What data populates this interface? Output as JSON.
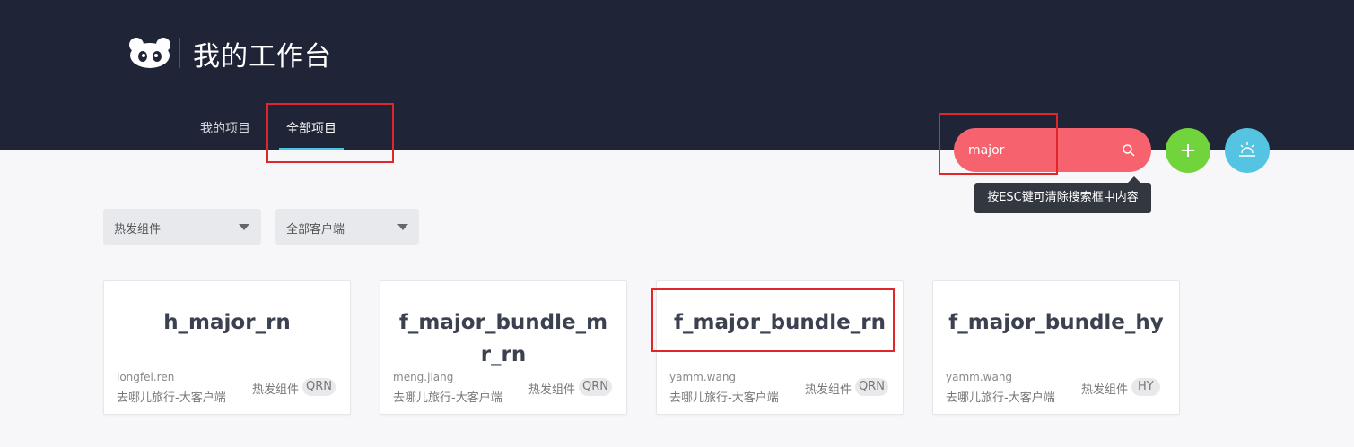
{
  "header": {
    "title": "我的工作台",
    "tabs": [
      {
        "label": "我的项目"
      },
      {
        "label": "全部项目"
      }
    ]
  },
  "search": {
    "value": "major",
    "tooltip": "按ESC键可清除搜索框中内容"
  },
  "colors": {
    "header_bg": "#1f2536",
    "search_bg": "#f6636e",
    "add_button": "#72d43c",
    "theme_button": "#55c4e2",
    "tab_underline": "#4fc3e8"
  },
  "filters": [
    {
      "selected": "热发组件"
    },
    {
      "selected": "全部客户端"
    }
  ],
  "cards": [
    {
      "title": "h_major_rn",
      "owner": "longfei.ren",
      "org": "去哪儿旅行-大客户端",
      "category": "热发组件",
      "badge": "QRN"
    },
    {
      "title": "f_major_bundle_mr_rn",
      "owner": "meng.jiang",
      "org": "去哪儿旅行-大客户端",
      "category": "热发组件",
      "badge": "QRN"
    },
    {
      "title": "f_major_bundle_rn",
      "owner": "yamm.wang",
      "org": "去哪儿旅行-大客户端",
      "category": "热发组件",
      "badge": "QRN"
    },
    {
      "title": "f_major_bundle_hy",
      "owner": "yamm.wang",
      "org": "去哪儿旅行-大客户端",
      "category": "热发组件",
      "badge": "HY"
    }
  ]
}
